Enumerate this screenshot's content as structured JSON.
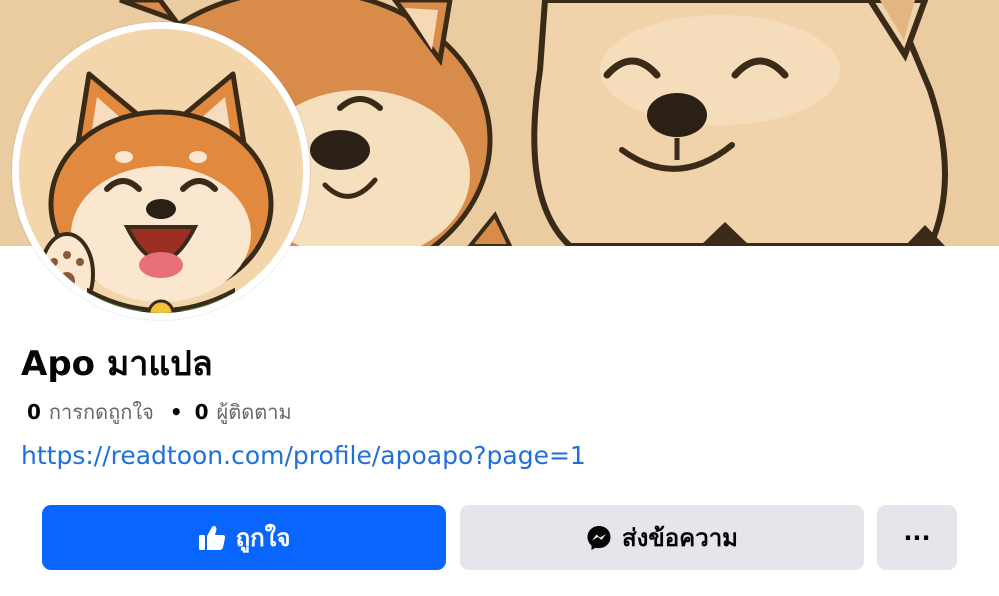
{
  "profile": {
    "name": "Apo มาแปล",
    "likes_count": "0",
    "likes_label": "การกดถูกใจ",
    "separator": "•",
    "followers_count": "0",
    "followers_label": "ผู้ติดตาม",
    "website": "https://readtoon.com/profile/apoapo?page=1"
  },
  "actions": {
    "like_label": "ถูกใจ",
    "message_label": "ส่งข้อความ",
    "more_label": "···"
  },
  "images": {
    "cover": "cartoon shiba inu and cream puppy cover photo",
    "avatar": "cartoon shiba inu waving profile picture"
  },
  "icons": {
    "like": "thumbs-up-icon",
    "message": "messenger-icon",
    "more": "more-dots-icon"
  },
  "colors": {
    "primary": "#0866ff",
    "link": "#216fdb",
    "secondary_button": "#e4e6eb",
    "text": "#050505",
    "muted_text": "#65676b"
  }
}
